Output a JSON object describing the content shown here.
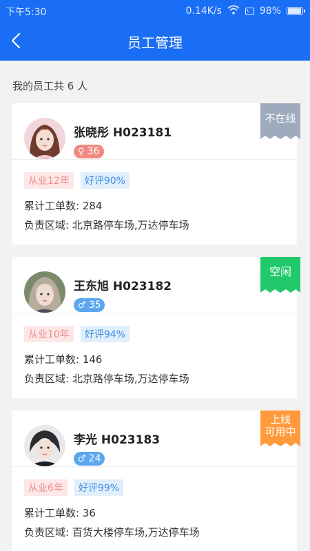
{
  "statusbar": {
    "time": "下午5:30",
    "speed": "0.14K/s",
    "battery": "98%",
    "icons": [
      "wifi-icon",
      "sim-icon",
      "battery-icon"
    ]
  },
  "navbar": {
    "title": "员工管理",
    "back_icon": "chevron-left-icon"
  },
  "summary": "我的员工共 6 人",
  "colors": {
    "primary": "#1a6ef5",
    "offline": "#9eabbe",
    "idle": "#21c96b",
    "online_available": "#ff9a3c"
  },
  "employees": [
    {
      "name": "张晓彤 H023181",
      "gender_symbol": "♀",
      "age": "36",
      "status": "不在线",
      "experience": "从业12年",
      "rating": "好评90%",
      "orders": "累计工单数: 284",
      "area": "负责区域: 北京路停车场,万达停车场"
    },
    {
      "name": "王东旭 H023182",
      "gender_symbol": "♂",
      "age": "35",
      "status": "空闲",
      "experience": "从业10年",
      "rating": "好评94%",
      "orders": "累计工单数: 146",
      "area": "负责区域: 北京路停车场,万达停车场"
    },
    {
      "name": "李光 H023183",
      "gender_symbol": "♂",
      "age": "24",
      "status_line1": "上线",
      "status_line2": "可用中",
      "experience": "从业6年",
      "rating": "好评99%",
      "orders": "累计工单数: 36",
      "area": "负责区域: 百货大楼停车场,万达停车场"
    }
  ]
}
